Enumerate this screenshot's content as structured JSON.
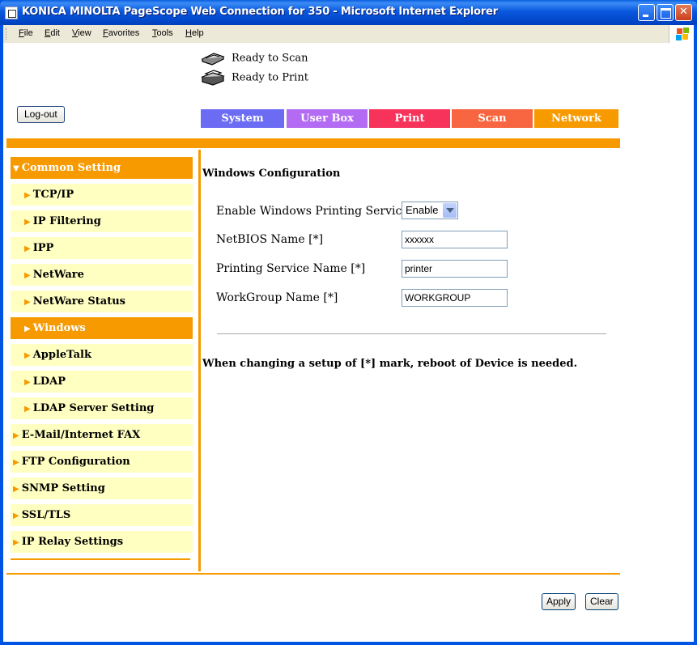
{
  "window": {
    "title": "KONICA MINOLTA PageScope Web Connection for 350 - Microsoft Internet Explorer"
  },
  "menu": [
    "File",
    "Edit",
    "View",
    "Favorites",
    "Tools",
    "Help"
  ],
  "status": {
    "scan": "Ready to Scan",
    "print": "Ready to Print"
  },
  "logout_label": "Log-out",
  "tabs": [
    {
      "label": "System",
      "color": "#6b6bf3"
    },
    {
      "label": "User Box",
      "color": "#b36bf3"
    },
    {
      "label": "Print",
      "color": "#f7335c"
    },
    {
      "label": "Scan",
      "color": "#f76640"
    },
    {
      "label": "Network",
      "color": "#f79a00"
    }
  ],
  "sidebar": {
    "items": [
      {
        "label": "Common Setting",
        "level": 1,
        "active": true,
        "expanded": true
      },
      {
        "label": "TCP/IP",
        "level": 2,
        "active": false
      },
      {
        "label": "IP Filtering",
        "level": 2,
        "active": false
      },
      {
        "label": "IPP",
        "level": 2,
        "active": false
      },
      {
        "label": "NetWare",
        "level": 2,
        "active": false
      },
      {
        "label": "NetWare Status",
        "level": 2,
        "active": false
      },
      {
        "label": "Windows",
        "level": 2,
        "active": true
      },
      {
        "label": "AppleTalk",
        "level": 2,
        "active": false
      },
      {
        "label": "LDAP",
        "level": 2,
        "active": false
      },
      {
        "label": "LDAP Server Setting",
        "level": 2,
        "active": false
      },
      {
        "label": "E-Mail/Internet FAX",
        "level": 1,
        "active": false
      },
      {
        "label": "FTP Configuration",
        "level": 1,
        "active": false
      },
      {
        "label": "SNMP Setting",
        "level": 1,
        "active": false
      },
      {
        "label": "SSL/TLS",
        "level": 1,
        "active": false
      },
      {
        "label": "IP Relay Settings",
        "level": 1,
        "active": false
      }
    ]
  },
  "main": {
    "title": "Windows Configuration",
    "fields": {
      "printing_service": {
        "label": "Enable Windows Printing Service",
        "value": "Enable"
      },
      "netbios": {
        "label": "NetBIOS Name [*]",
        "value": "xxxxxx"
      },
      "service_name": {
        "label": "Printing Service Name [*]",
        "value": "printer"
      },
      "workgroup": {
        "label": "WorkGroup Name [*]",
        "value": "WORKGROUP"
      }
    },
    "note": "When changing a setup of [*] mark, reboot of Device is needed."
  },
  "buttons": {
    "apply": "Apply",
    "clear": "Clear"
  },
  "colors": {
    "accent": "#f79a00",
    "sidebar_bg": "#ffffc2"
  }
}
